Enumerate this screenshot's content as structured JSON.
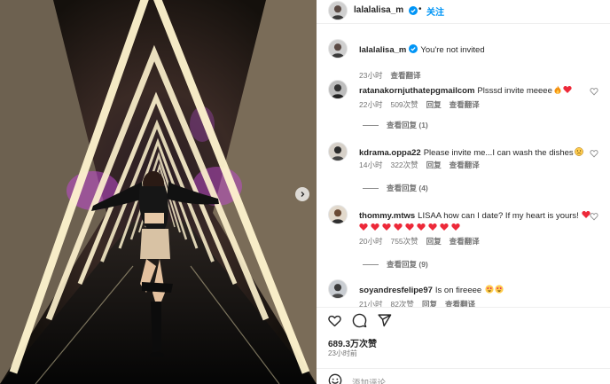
{
  "post": {
    "author": "lalalalisa_m",
    "separator": "•",
    "follow_label": "关注"
  },
  "comments": [
    {
      "username": "lalalalisa_m",
      "text": "You're not invited",
      "time": "23小时",
      "translate": "查看翻译",
      "verified": true
    },
    {
      "username": "ratanakornjuthatepgmailcom",
      "text": "Plsssd invite meeee",
      "time": "22小时",
      "likes": "509次赞",
      "reply": "回复",
      "translate": "查看翻译",
      "replies": "查看回复 (1)"
    },
    {
      "username": "kdrama.oppa22",
      "text": "Please invite me...I can wash the dishes",
      "time": "14小时",
      "likes": "322次赞",
      "reply": "回复",
      "translate": "查看翻译",
      "replies": "查看回复 (4)"
    },
    {
      "username": "thommy.mtws",
      "text": "LISAA how can I date? If my heart is yours!",
      "time": "20小时",
      "likes": "755次赞",
      "reply": "回复",
      "translate": "查看翻译",
      "replies": "查看回复 (9)"
    },
    {
      "username": "soyandresfelipe97",
      "text": "Is on fireeee",
      "time": "21小时",
      "likes": "82次赞",
      "reply": "回复",
      "translate": "查看翻译"
    }
  ],
  "footer": {
    "likes": "689.3万次赞",
    "time": "23小时前",
    "add_comment_placeholder": "添加评论..."
  },
  "icons": {
    "like": "heart-outline-icon",
    "comment": "comment-bubble-icon",
    "share": "paper-plane-icon",
    "emoji": "smiley-icon",
    "verified": "verified-badge-icon",
    "carousel_next": "chevron-right-icon"
  },
  "colors": {
    "accent": "#0095f6",
    "heart_red": "#ed4956",
    "muted_text": "#737373"
  }
}
